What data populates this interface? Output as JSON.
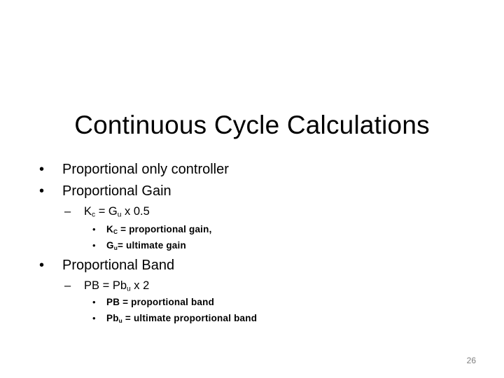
{
  "slide": {
    "title": "Continuous Cycle Calculations",
    "bullets": [
      {
        "text": "Proportional only controller"
      },
      {
        "text": "Proportional Gain",
        "formula": {
          "lhs": "K",
          "lhs_sub": "c",
          "mid": " = G",
          "mid_sub": "u",
          "rhs": " x 0.5"
        },
        "definitions": [
          {
            "sym": "K",
            "sym_sub": "C",
            "text": " = proportional gain,"
          },
          {
            "sym": "G",
            "sym_sub": "u",
            "text": "= ultimate gain"
          }
        ]
      },
      {
        "text": "Proportional Band",
        "formula": {
          "lhs": "PB = Pb",
          "lhs_sub": "u",
          "rhs": " x 2"
        },
        "definitions": [
          {
            "sym": "PB",
            "sym_sub": "",
            "text": " = proportional band"
          },
          {
            "sym": "Pb",
            "sym_sub": "u",
            "text": " = ultimate proportional band"
          }
        ]
      }
    ],
    "bullet_glyph": "•",
    "dash_glyph": "–",
    "page_number": "26"
  }
}
